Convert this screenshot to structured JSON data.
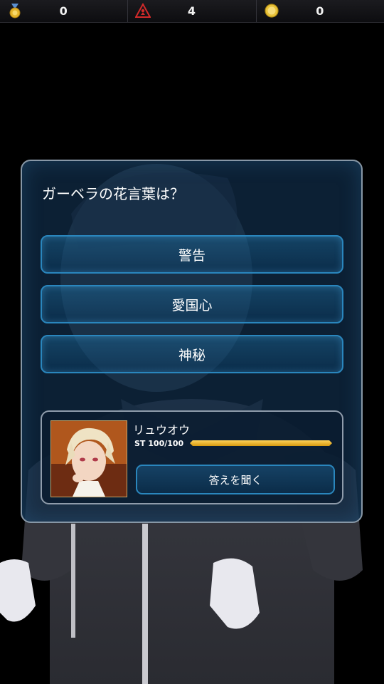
{
  "topbar": {
    "medals": {
      "icon": "medal-icon",
      "value": "0"
    },
    "warnings": {
      "icon": "warning-icon",
      "value": "4"
    },
    "coins": {
      "icon": "coin-icon",
      "value": "0"
    }
  },
  "quiz": {
    "question": "ガーベラの花言葉は？",
    "choices": [
      "警告",
      "愛国心",
      "神秘"
    ]
  },
  "helper": {
    "name": "リュウオウ",
    "stamina_label": "ST 100/100",
    "stamina_fraction": 1.0,
    "ask_button": "答えを聞く"
  },
  "colors": {
    "accent_blue": "#2a86bd",
    "stamina_gold": "#e3a818",
    "panel_border": "#8797a6"
  }
}
